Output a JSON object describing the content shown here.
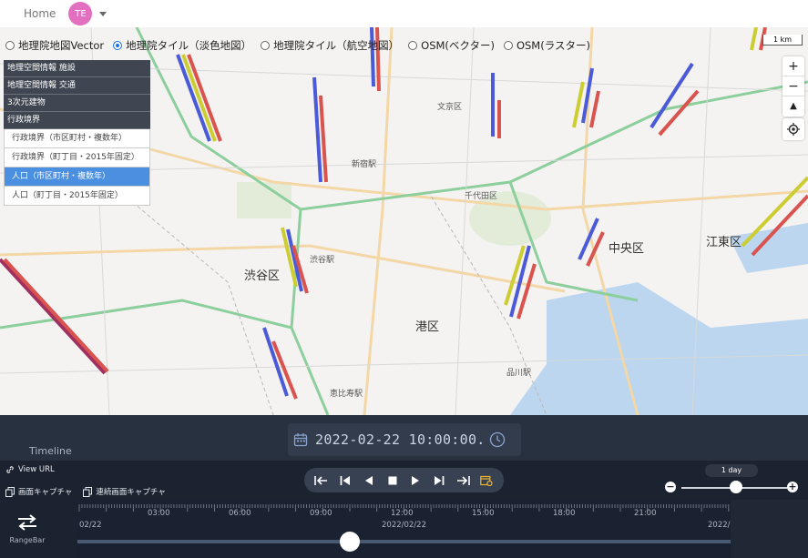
{
  "topbar": {
    "home_label": "Home",
    "avatar_initials": "TE"
  },
  "map": {
    "layer_options": [
      {
        "label": "地理院地図Vector",
        "selected": false
      },
      {
        "label": "地理院タイル（淡色地図）",
        "selected": true
      },
      {
        "label": "地理院タイル（航空地図）",
        "selected": false
      },
      {
        "label": "OSM(ベクター)",
        "selected": false
      },
      {
        "label": "OSM(ラスター)",
        "selected": false
      }
    ],
    "layer_groups": [
      "地理空間情報 施設",
      "地理空間情報 交通",
      "3次元建物",
      "行政境界"
    ],
    "layer_items": [
      {
        "label": "行政境界（市区町村・複数年）",
        "active": false
      },
      {
        "label": "行政境界（町丁目・2015年固定）",
        "active": false
      },
      {
        "label": "人口（市区町村・複数年）",
        "active": true
      },
      {
        "label": "人口（町丁目・2015年固定）",
        "active": false
      }
    ],
    "scale_label": "1 km",
    "zoom_in": "+",
    "zoom_out": "−",
    "compass": "▲",
    "place_labels": {
      "shibuya": "渋谷区",
      "minato": "港区",
      "chuo": "中央区",
      "koto": "江東区",
      "shinjuku": "新宿駅",
      "bunkyo": "文京区",
      "chiyoda": "千代田区",
      "ebisu": "恵比寿駅",
      "shibuya_st": "渋谷駅",
      "shinagawa": "品川駅"
    }
  },
  "timeline": {
    "title": "Timeline",
    "datetime": "2022-02-22 10:00:00.",
    "view_url_label": "View URL",
    "capture_label": "画面キャプチャ",
    "continuous_capture_label": "連続画面キャプチャ",
    "speed_label": "1 day",
    "speed_minus": "−",
    "speed_plus": "+",
    "rangebar_label": "RangeBar",
    "ticks": [
      "03:00",
      "06:00",
      "09:00",
      "12:00",
      "15:00",
      "18:00",
      "21:00"
    ],
    "dates": [
      "02/22",
      "2022/02/22",
      "2022/"
    ]
  },
  "colors": {
    "accent": "#1a73e8",
    "bar_blue": "#4b5bd8",
    "bar_red": "#d9534f",
    "bar_yellow": "#cccc33",
    "timeline_bg": "#1c2330"
  }
}
